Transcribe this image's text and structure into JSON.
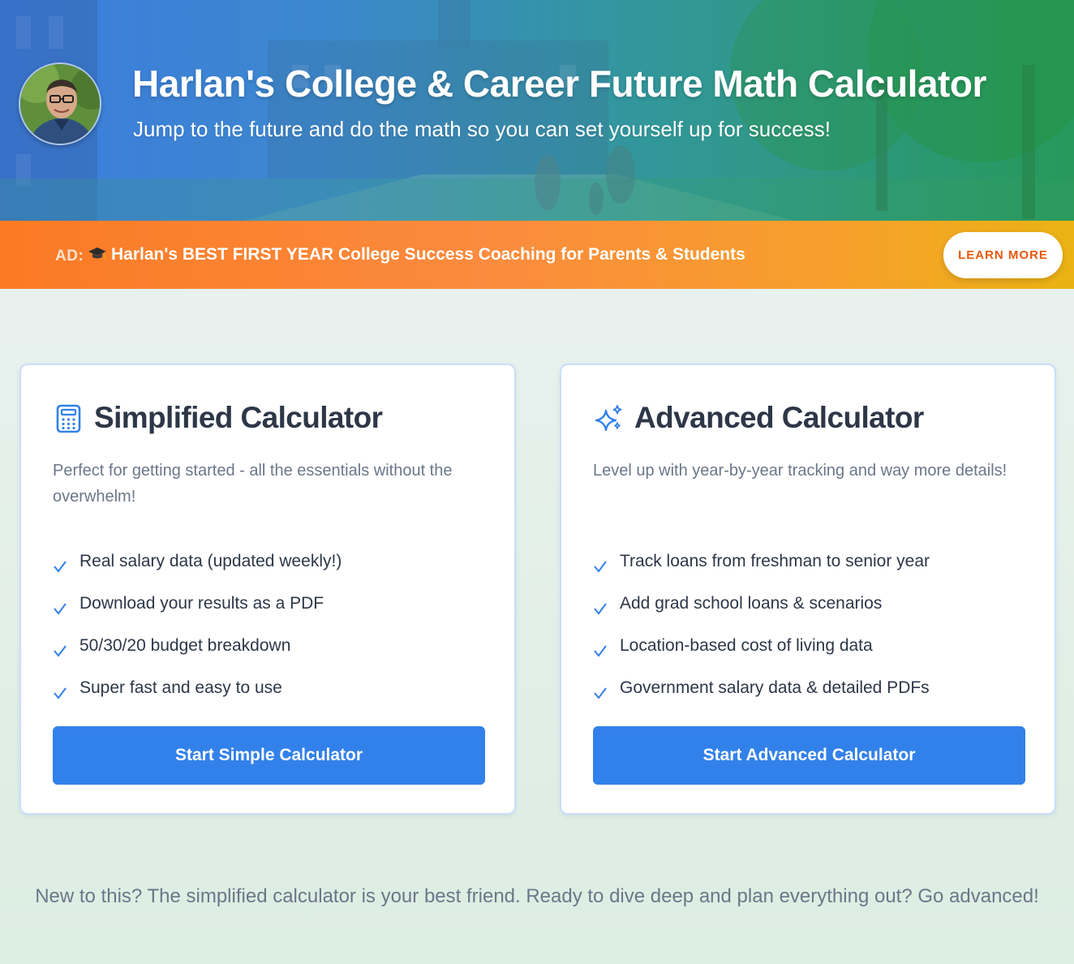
{
  "hero": {
    "title": "Harlan's College & Career Future Math Calculator",
    "subtitle": "Jump to the future and do the math so you can set yourself up for success!",
    "avatar_icon": "person-photo"
  },
  "ad": {
    "prefix": "AD:",
    "icon": "graduation-cap-icon",
    "text": "Harlan's BEST FIRST YEAR College Success Coaching for Parents & Students",
    "button_label": "LEARN MORE"
  },
  "cards": [
    {
      "icon": "calculator-icon",
      "title": "Simplified Calculator",
      "description": "Perfect for getting started - all the essentials without the overwhelm!",
      "features": [
        "Real salary data (updated weekly!)",
        "Download your results as a PDF",
        "50/30/20 budget breakdown",
        "Super fast and easy to use"
      ],
      "button_label": "Start Simple Calculator"
    },
    {
      "icon": "sparkles-icon",
      "title": "Advanced Calculator",
      "description": "Level up with year-by-year tracking and way more details!",
      "features": [
        "Track loans from freshman to senior year",
        "Add grad school loans & scenarios",
        "Location-based cost of living data",
        "Government salary data & detailed PDFs"
      ],
      "button_label": "Start Advanced Calculator"
    }
  ],
  "footer": {
    "note": "New to this? The simplified calculator is your best friend. Ready to dive deep and plan everything out? Go advanced!"
  },
  "colors": {
    "primary_button": "#3281ea",
    "check_icon": "#3281ea",
    "learn_more_text": "#e8590c",
    "ad_gradient_start": "#fb7a24",
    "ad_gradient_end": "#eab313",
    "hero_gradient_start": "#3b7fe6",
    "hero_gradient_end": "#22a052"
  }
}
